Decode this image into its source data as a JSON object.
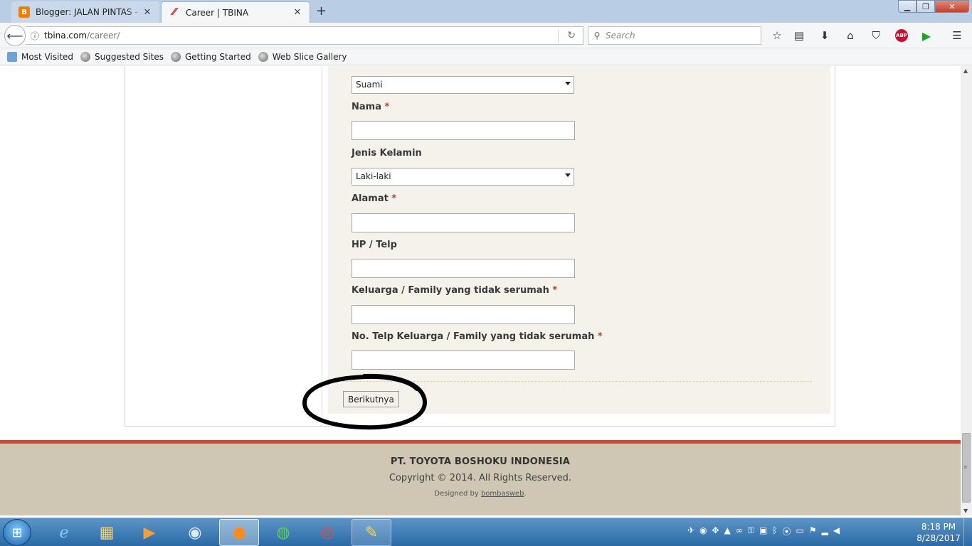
{
  "browser": {
    "tabs": [
      {
        "label": "Blogger: JALAN PINTAS - Ser",
        "favicon": "blogger-icon",
        "active": false
      },
      {
        "label": "Career | TBINA",
        "favicon": "tbina-icon",
        "active": true
      }
    ],
    "url_host": "tbina.com",
    "url_path": "/career/",
    "search_placeholder": "Search",
    "bookmarks": [
      "Most Visited",
      "Suggested Sites",
      "Getting Started",
      "Web Slice Gallery"
    ]
  },
  "form": {
    "relation_select_value": "Suami",
    "fields": {
      "nama_label": "Nama",
      "jenis_kelamin_label": "Jenis Kelamin",
      "jenis_kelamin_value": "Laki-laki",
      "alamat_label": "Alamat",
      "hp_label": "HP / Telp",
      "keluarga_label": "Keluarga / Family yang tidak serumah",
      "no_telp_keluarga_label": "No. Telp Keluarga / Family yang tidak serumah"
    },
    "required_marker": "*",
    "next_button": "Berikutnya"
  },
  "footer": {
    "company": "PT. TOYOTA BOSHOKU INDONESIA",
    "copyright": "Copyright © 2014. All Rights Reserved.",
    "designed_prefix": "Designed by",
    "designed_link": "bombasweb",
    "designed_suffix": ".",
    "accent_color": "#d9452b"
  },
  "taskbar": {
    "apps": [
      "internet-explorer-icon",
      "file-explorer-icon",
      "media-player-icon",
      "disc-burner-icon",
      "firefox-icon",
      "media-center-icon",
      "chrome-icon",
      "paint-icon"
    ],
    "time": "8:18 PM",
    "date": "8/28/2017"
  }
}
